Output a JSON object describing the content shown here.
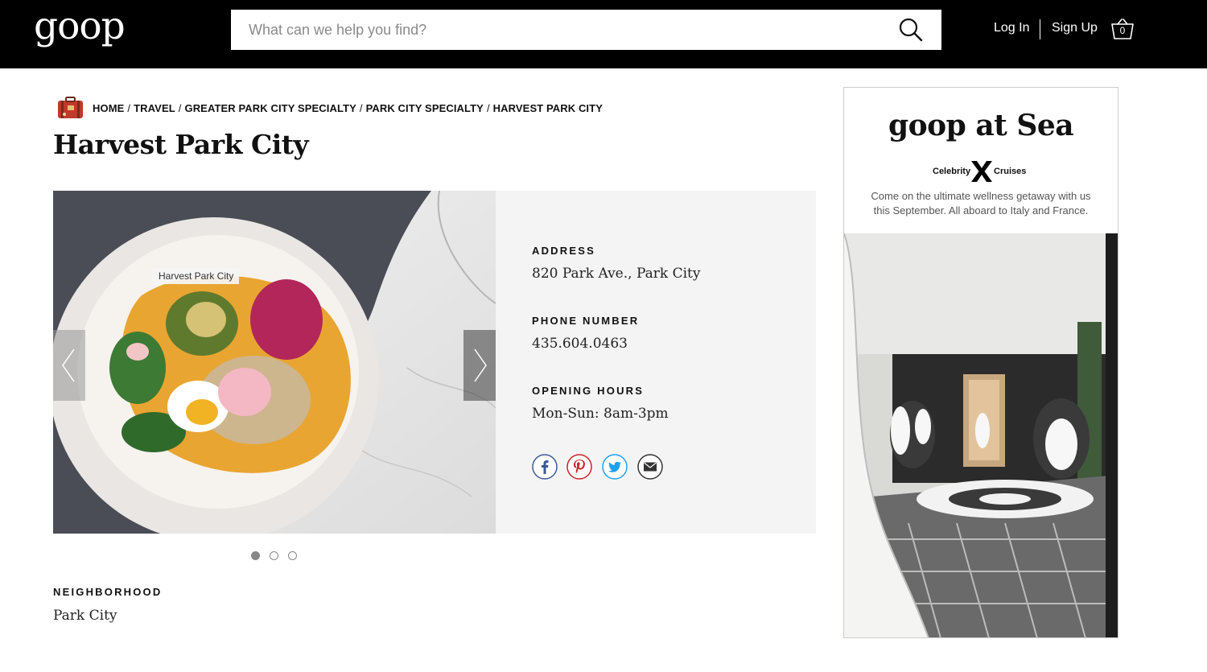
{
  "header": {
    "logo": "goop",
    "search_placeholder": "What can we help you find?",
    "login": "Log In",
    "signup": "Sign Up",
    "cart_count": "0"
  },
  "breadcrumb": [
    "HOME",
    "TRAVEL",
    "GREATER PARK CITY SPECIALTY",
    "PARK CITY SPECIALTY",
    "HARVEST PARK CITY"
  ],
  "breadcrumb_sep": "/",
  "page": {
    "title": "Harvest Park City",
    "image_caption": "Harvest Park City",
    "carousel_slides": 3,
    "carousel_active": 1
  },
  "details": {
    "address_label": "ADDRESS",
    "address": "820 Park Ave., Park City",
    "phone_label": "PHONE NUMBER",
    "phone": "435.604.0463",
    "hours_label": "OPENING HOURS",
    "hours": "Mon-Sun: 8am-3pm",
    "neighborhood_label": "NEIGHBORHOOD",
    "neighborhood": "Park City"
  },
  "share_icons": [
    "facebook-icon",
    "pinterest-icon",
    "twitter-icon",
    "email-icon"
  ],
  "ad": {
    "title": "goop at Sea",
    "brand_left": "Celebrity",
    "brand_right": "Cruises",
    "copy": "Come on the ultimate wellness getaway with us this September. All aboard to Italy and France."
  },
  "colors": {
    "header_bg": "#000000",
    "panel_bg": "#f4f4f4",
    "facebook": "#3b5998",
    "pinterest": "#cb2027",
    "twitter": "#1da1f2"
  }
}
